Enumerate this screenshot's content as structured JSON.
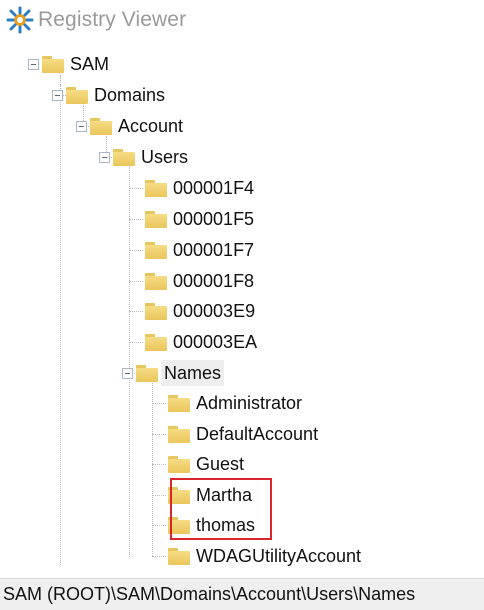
{
  "window": {
    "title": "Registry Viewer",
    "icon": "registry-viewer-icon"
  },
  "tree": {
    "sam": "SAM",
    "domains": "Domains",
    "account": "Account",
    "users": "Users",
    "user_keys": [
      "000001F4",
      "000001F5",
      "000001F7",
      "000001F8",
      "000003E9",
      "000003EA"
    ],
    "names": "Names",
    "name_entries": [
      "Administrator",
      "DefaultAccount",
      "Guest",
      "Martha",
      "thomas",
      "WDAGUtilityAccount"
    ],
    "selected": "Names",
    "highlighted": [
      "Martha",
      "thomas"
    ],
    "highlight_color": "#d9262c",
    "folder_color": "#eac65c"
  },
  "statusbar": {
    "path": "SAM (ROOT)\\SAM\\Domains\\Account\\Users\\Names"
  }
}
